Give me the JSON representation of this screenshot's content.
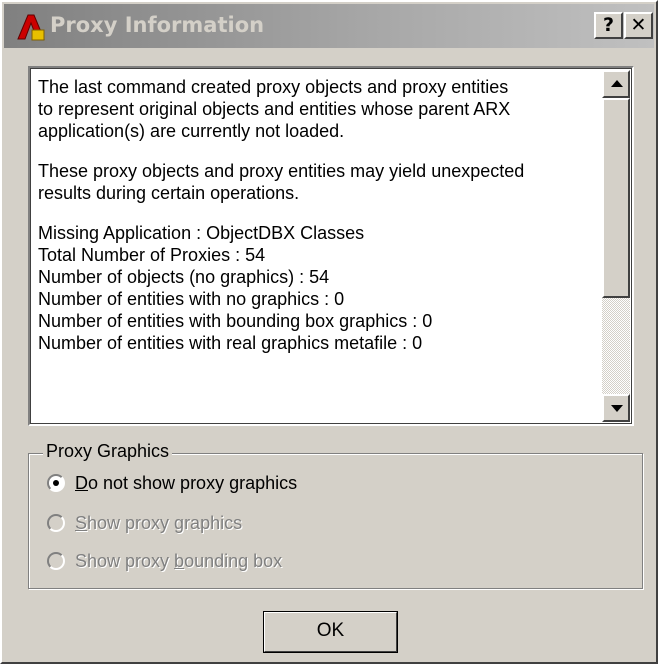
{
  "window": {
    "title": "Proxy Information",
    "help_label": "?",
    "close_label": "✕"
  },
  "message": {
    "para1": [
      "The last command created proxy objects and proxy entities",
      "to represent original objects and entities whose parent ARX",
      "application(s) are currently not loaded."
    ],
    "para2": [
      "These proxy objects and proxy entities may yield unexpected",
      "results during certain operations."
    ],
    "para3": [
      "Missing Application : ObjectDBX Classes",
      "Total Number of Proxies : 54",
      "Number of objects (no graphics) : 54",
      "Number of entities with no graphics : 0",
      "Number of entities with bounding box graphics : 0",
      "Number of entities with real graphics metafile : 0"
    ]
  },
  "proxy_graphics": {
    "legend": "Proxy Graphics",
    "options": [
      {
        "pre": "",
        "ul": "D",
        "post": "o not show proxy graphics",
        "selected": true,
        "enabled": true
      },
      {
        "pre": "",
        "ul": "S",
        "post": "how proxy graphics",
        "selected": false,
        "enabled": false
      },
      {
        "pre": "Show proxy ",
        "ul": "b",
        "post": "ounding box",
        "selected": false,
        "enabled": false
      }
    ]
  },
  "ok_label": "OK",
  "colors": {
    "face": "#d4d0c8",
    "titlebar_start": "#808080",
    "titlebar_end": "#c0c0c0",
    "icon_red": "#cc0000"
  },
  "icons": {
    "app": "autocad-icon",
    "scroll_up": "arrow-up-icon",
    "scroll_down": "arrow-down-icon"
  }
}
